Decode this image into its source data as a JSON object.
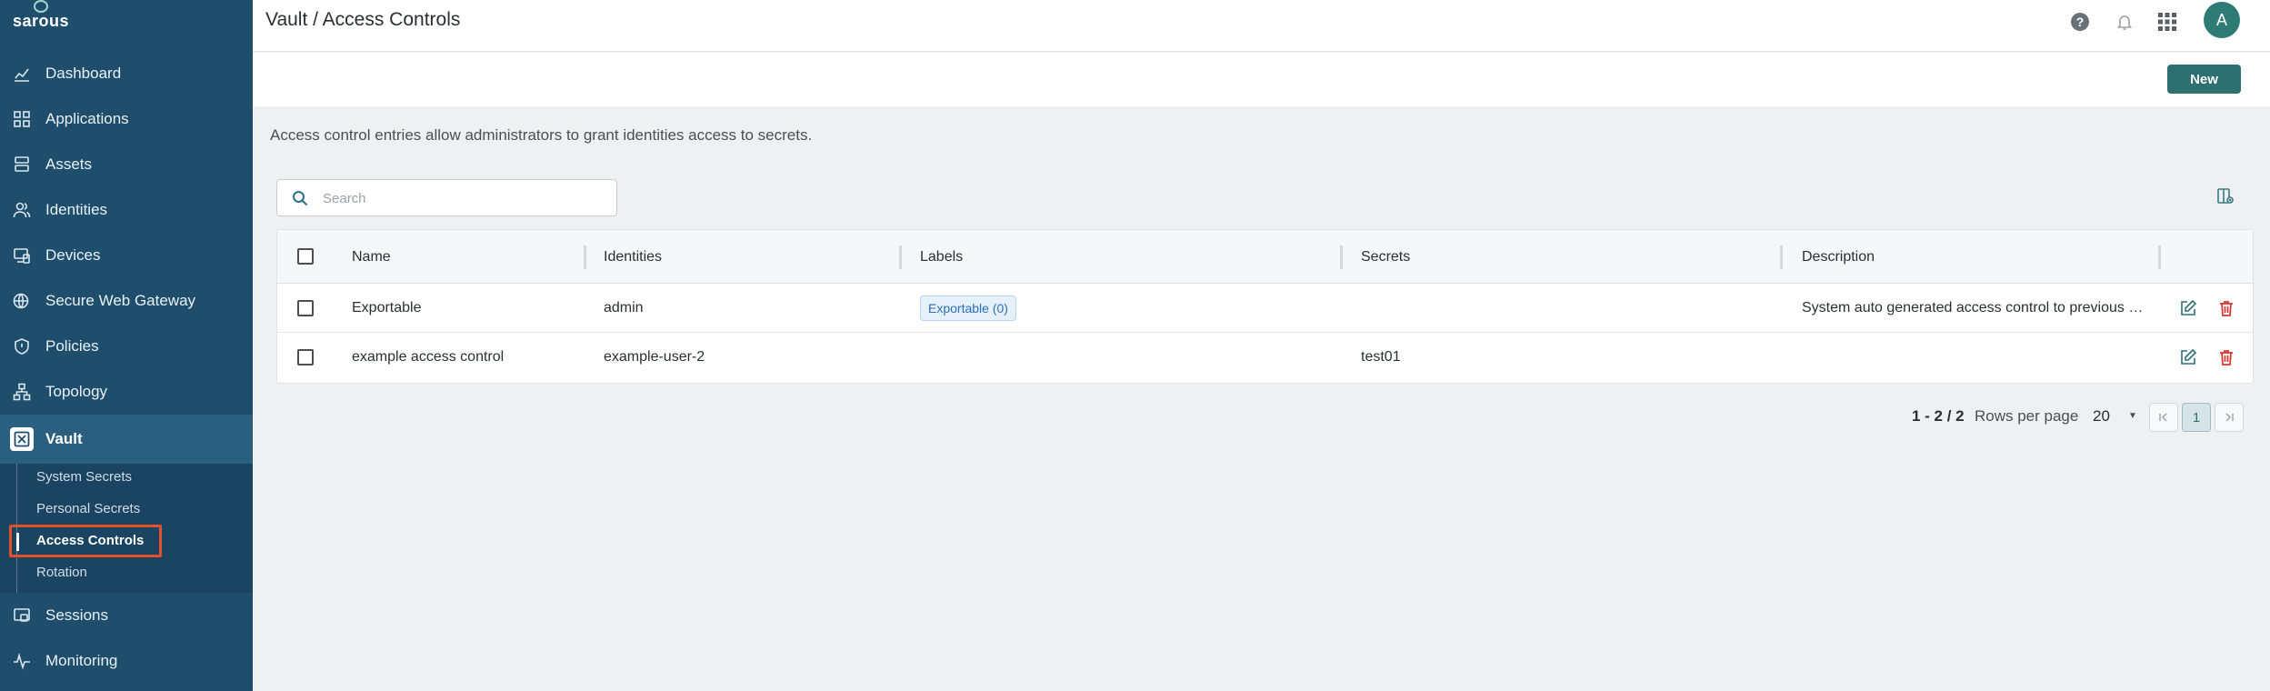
{
  "app": {
    "logo_text": "sarous"
  },
  "sidebar": {
    "items": [
      {
        "label": "Dashboard",
        "icon": "dashboard-chart-icon"
      },
      {
        "label": "Applications",
        "icon": "grid-icon"
      },
      {
        "label": "Assets",
        "icon": "server-icon"
      },
      {
        "label": "Identities",
        "icon": "users-icon"
      },
      {
        "label": "Devices",
        "icon": "devices-icon"
      },
      {
        "label": "Secure Web Gateway",
        "icon": "globe-shield-icon"
      },
      {
        "label": "Policies",
        "icon": "shield-icon"
      },
      {
        "label": "Topology",
        "icon": "topology-icon"
      },
      {
        "label": "Vault",
        "icon": "vault-icon",
        "active": true
      },
      {
        "label": "Sessions",
        "icon": "sessions-icon"
      },
      {
        "label": "Monitoring",
        "icon": "pulse-icon"
      }
    ],
    "vault_sub": [
      {
        "label": "System Secrets"
      },
      {
        "label": "Personal Secrets"
      },
      {
        "label": "Access Controls",
        "active": true
      },
      {
        "label": "Rotation"
      }
    ]
  },
  "header": {
    "breadcrumb": "Vault / Access Controls",
    "avatar_initial": "A",
    "icons": [
      "help-icon",
      "bell-icon",
      "apps-grid-icon"
    ]
  },
  "toolbar": {
    "new_label": "New"
  },
  "page": {
    "description": "Access control entries allow administrators to grant identities access to secrets."
  },
  "search": {
    "placeholder": "Search",
    "value": ""
  },
  "table": {
    "columns": [
      "Name",
      "Identities",
      "Labels",
      "Secrets",
      "Description"
    ],
    "rows": [
      {
        "name": "Exportable",
        "identities": "admin",
        "label": "Exportable (0)",
        "secrets": "",
        "description": "System auto generated access control to previous versions"
      },
      {
        "name": "example access control",
        "identities": "example-user-2",
        "label": "",
        "secrets": "test01",
        "description": ""
      }
    ]
  },
  "pagination": {
    "range": "1 - 2 / 2",
    "rows_per_page_label": "Rows per page",
    "rows_per_page": "20",
    "current_page": "1"
  },
  "colors": {
    "sidebar": "#1f4e6d",
    "accent": "#2e6f72",
    "highlight": "#e4502a",
    "delete": "#d9342b"
  }
}
